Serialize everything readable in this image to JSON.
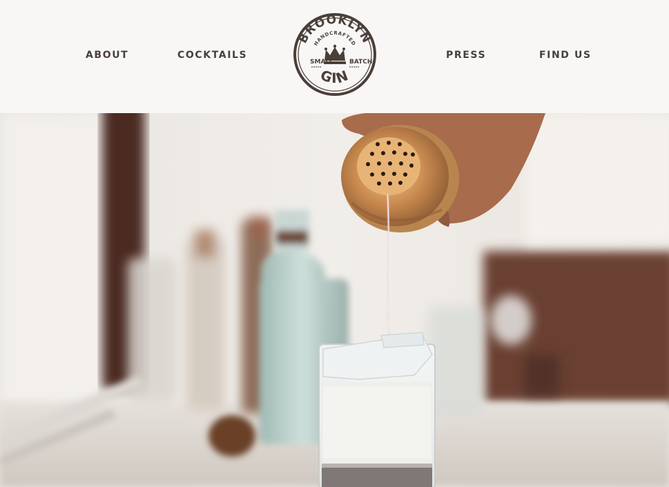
{
  "nav": {
    "left": [
      {
        "label": "ABOUT"
      },
      {
        "label": "COCKTAILS"
      }
    ],
    "right": [
      {
        "label": "PRESS"
      },
      {
        "label": "FIND US"
      }
    ]
  },
  "logo": {
    "top": "BROOKLYN",
    "sub": "HANDCRAFTED",
    "left": "SMALL",
    "right": "BATCH",
    "bottom": "GIN",
    "icon": "crown-icon"
  },
  "hero": {
    "subject": "cocktail-pour-photo"
  },
  "colors": {
    "text": "#4a3f39",
    "header_bg": "#f8f7f6",
    "copper": "#c98a4f"
  }
}
